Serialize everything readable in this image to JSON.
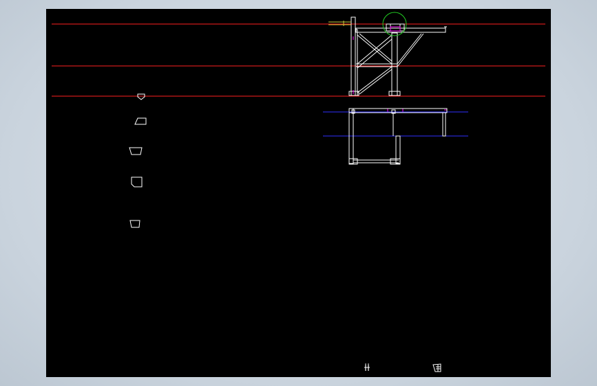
{
  "app": {
    "title": ""
  },
  "canvas": {
    "background": "#000000",
    "frame_color": "#d0d9e2",
    "layers": {
      "guide_lines": {
        "color": "#ff0000"
      },
      "section_lines": {
        "color": "#0000ff"
      },
      "construction": {
        "color": "#ff00ff"
      },
      "geometry": {
        "color": "#ffffff"
      },
      "circle": {
        "color": "#00cc00"
      },
      "bolt": {
        "color": "#cccc33"
      }
    }
  },
  "icons": {
    "snap_icon": "snap-glyph",
    "layer_icon": "layer-glyph"
  },
  "status": {
    "snap_glyph": "ı̈",
    "layer_glyph": ""
  }
}
